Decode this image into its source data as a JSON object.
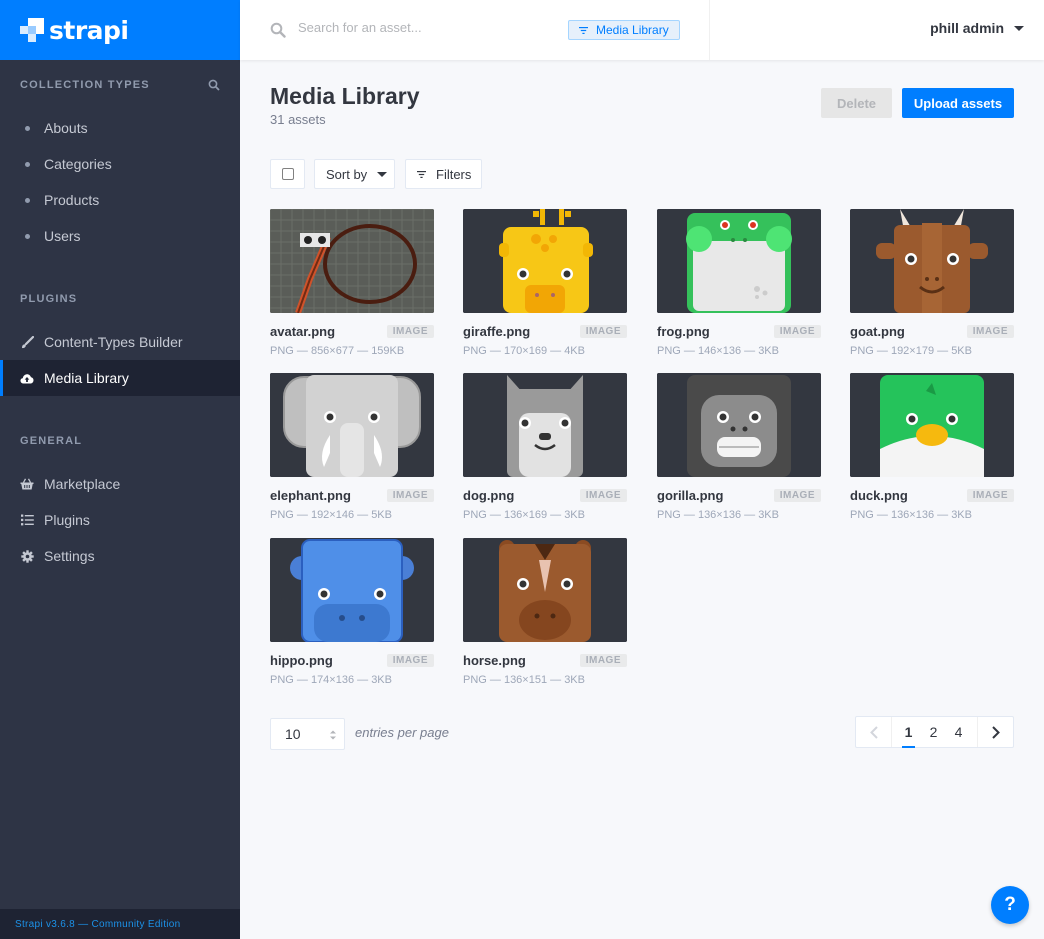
{
  "brand": {
    "name": "strapi"
  },
  "sidebar": {
    "collection_title": "Collection Types",
    "collection_items": [
      {
        "label": "Abouts"
      },
      {
        "label": "Categories"
      },
      {
        "label": "Products"
      },
      {
        "label": "Users"
      }
    ],
    "plugins_title": "Plugins",
    "plugin_items": [
      {
        "label": "Content-Types Builder",
        "icon": "paint-brush-icon"
      },
      {
        "label": "Media Library",
        "icon": "cloud-upload-icon",
        "active": true
      }
    ],
    "general_title": "General",
    "general_items": [
      {
        "label": "Marketplace",
        "icon": "shopping-basket-icon"
      },
      {
        "label": "Plugins",
        "icon": "list-icon"
      },
      {
        "label": "Settings",
        "icon": "gear-icon"
      }
    ],
    "footer": "Strapi v3.6.8 — Community Edition"
  },
  "topbar": {
    "search_placeholder": "Search for an asset...",
    "scope_tag": "Media Library",
    "user": "phill admin"
  },
  "main": {
    "title": "Media Library",
    "subtitle": "31 assets",
    "delete_label": "Delete",
    "upload_label": "Upload assets",
    "sort_label": "Sort by",
    "filters_label": "Filters"
  },
  "assets": [
    {
      "name": "avatar.png",
      "type": "IMAGE",
      "meta": "PNG — 856×677 — 159KB",
      "art": "avatar"
    },
    {
      "name": "giraffe.png",
      "type": "IMAGE",
      "meta": "PNG — 170×169 — 4KB",
      "art": "giraffe"
    },
    {
      "name": "frog.png",
      "type": "IMAGE",
      "meta": "PNG — 146×136 — 3KB",
      "art": "frog"
    },
    {
      "name": "goat.png",
      "type": "IMAGE",
      "meta": "PNG — 192×179 — 5KB",
      "art": "goat"
    },
    {
      "name": "elephant.png",
      "type": "IMAGE",
      "meta": "PNG — 192×146 — 5KB",
      "art": "elephant"
    },
    {
      "name": "dog.png",
      "type": "IMAGE",
      "meta": "PNG — 136×169 — 3KB",
      "art": "dog"
    },
    {
      "name": "gorilla.png",
      "type": "IMAGE",
      "meta": "PNG — 136×136 — 3KB",
      "art": "gorilla"
    },
    {
      "name": "duck.png",
      "type": "IMAGE",
      "meta": "PNG — 136×136 — 3KB",
      "art": "duck"
    },
    {
      "name": "hippo.png",
      "type": "IMAGE",
      "meta": "PNG — 174×136 — 3KB",
      "art": "hippo"
    },
    {
      "name": "horse.png",
      "type": "IMAGE",
      "meta": "PNG — 136×151 — 3KB",
      "art": "horse"
    }
  ],
  "pagination": {
    "per_page": "10",
    "per_page_label": "entries per page",
    "pages": [
      "1",
      "2",
      "4"
    ],
    "current": "1"
  },
  "help": {
    "label": "?"
  },
  "colors": {
    "accent": "#007eff",
    "sidebar": "#2e3445",
    "thumb_bg": "#333740"
  }
}
